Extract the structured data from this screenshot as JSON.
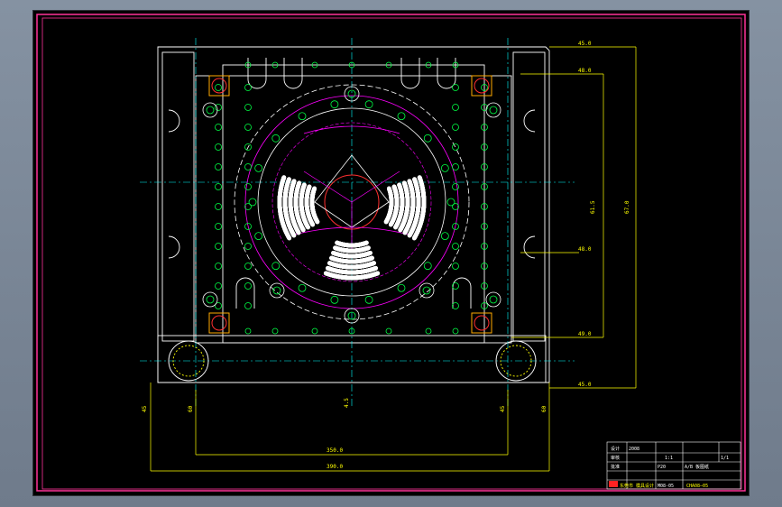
{
  "colors": {
    "background": "#000000",
    "frame": "#ff3399",
    "outline": "#ffffff",
    "holes": "#00ff44",
    "dims": "#ffff00",
    "centerlines": "#00ffff",
    "cooling": "#ff00ff",
    "cavity": "#ff3030",
    "accent": "#ffaa00"
  },
  "dimensions": {
    "right_side": [
      "45.0",
      "48.0",
      "61.5",
      "67.0",
      "48.0",
      "49.0",
      "45.0"
    ],
    "bottom_small": [
      "45",
      "60",
      "4.5",
      "45",
      "60"
    ],
    "bottom_long": [
      "350.0",
      "390.0"
    ]
  },
  "title_block": {
    "main_title": "CHA08—05",
    "company": "东莞市 模具设计",
    "drawing_name": "A/B 板图纸",
    "scale": "1:1",
    "material": "P20",
    "designer": "设计",
    "checker": "审核",
    "approver": "批准",
    "date": "2008",
    "sheet": "1/1",
    "drawing_number": "M08-05"
  }
}
